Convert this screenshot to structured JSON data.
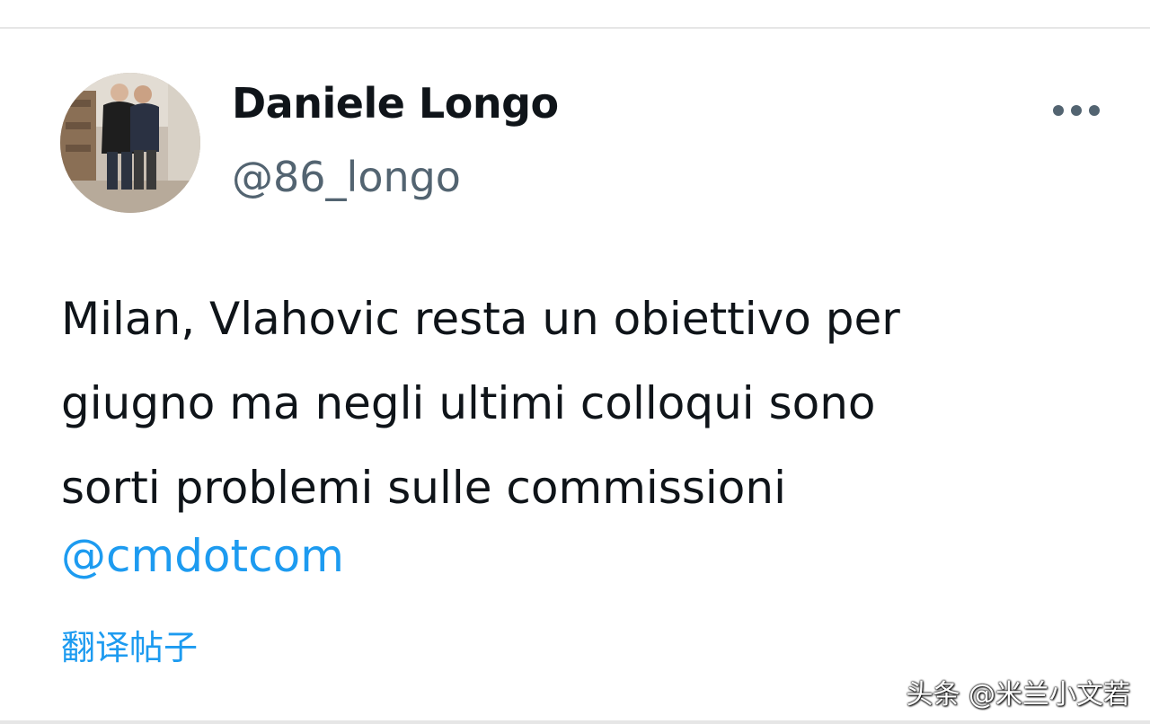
{
  "tweet": {
    "author": {
      "display_name": "Daniele Longo",
      "handle": "@86_longo",
      "avatar_icon": "profile-photo"
    },
    "text_lines": [
      "Milan, Vlahovic resta un obiettivo per",
      "giugno ma negli ultimi colloqui sono",
      "sorti problemi sulle commissioni"
    ],
    "mention": "@cmdotcom",
    "translate_label": "翻译帖子",
    "more_icon": "more-horizontal-icon"
  },
  "watermark": "头条 @米兰小文若",
  "colors": {
    "text": "#0f1419",
    "secondary": "#536471",
    "link": "#1d9bf0"
  }
}
